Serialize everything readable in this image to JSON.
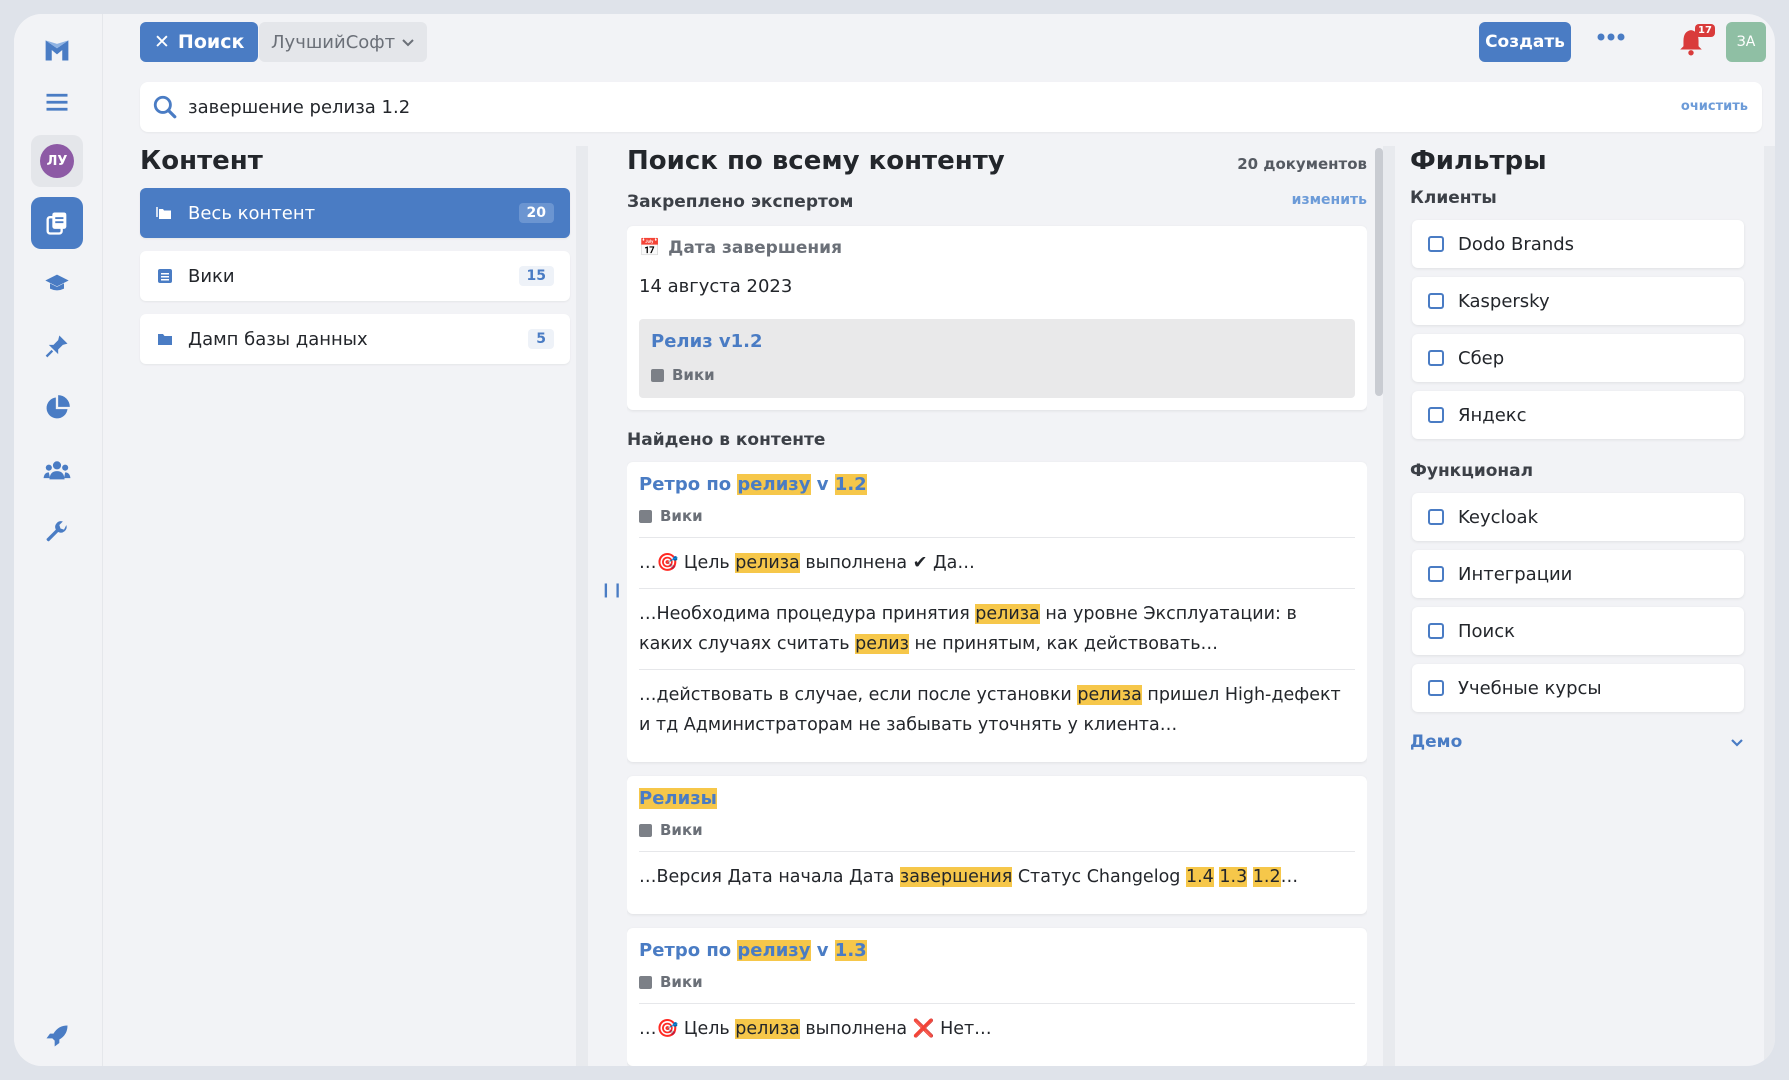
{
  "header": {
    "close_search_label": "Поиск",
    "workspace": "ЛучшийСофт",
    "create_label": "Создать",
    "notifications_count": "17",
    "user_initials": "ЗА"
  },
  "rail": {
    "user_initials": "ЛУ",
    "icons": [
      "menu-icon",
      "avatar",
      "content-icon",
      "courses-icon",
      "pin-icon",
      "analytics-icon",
      "team-icon",
      "settings-icon",
      "rocket-icon"
    ]
  },
  "search": {
    "query": "завершение релиза 1.2",
    "clear_label": "очистить"
  },
  "content": {
    "title": "Контент",
    "items": [
      {
        "label": "Весь контент",
        "count": "20"
      },
      {
        "label": "Вики",
        "count": "15"
      },
      {
        "label": "Дамп базы данных",
        "count": "5"
      }
    ]
  },
  "results": {
    "title": "Поиск по всему контенту",
    "doc_count": "20 документов",
    "pinned_label": "Закреплено экспертом",
    "edit_label": "изменить",
    "pinned": {
      "title": "Дата завершения",
      "date": "14 августа 2023",
      "linked_title": "Релиз v1.2",
      "linked_source": "Вики"
    },
    "found_label": "Найдено в контенте",
    "items": [
      {
        "title_parts": [
          "Ретро по ",
          "релизу",
          " v ",
          "1.2"
        ],
        "source": "Вики",
        "snippets": [
          "…🎯 Цель релиза выполнена ✔ Да…",
          "…Необходима процедура принятия релиза на уровне Эксплуатации: в каких случаях считать релиз не принятым, как действовать…",
          "…действовать в случае, если после установки релиза пришел High-дефект и тд Администраторам не забывать уточнять у клиента…"
        ]
      },
      {
        "title": "Релизы",
        "source": "Вики",
        "snippets": [
          "…Версия Дата начала Дата завершения Статус Changelog 1.4 1.3 1.2…"
        ]
      },
      {
        "title_parts": [
          "Ретро по ",
          "релизу",
          " v ",
          "1.3"
        ],
        "source": "Вики",
        "snippets": [
          "…🎯 Цель релиза выполнена ❌ Нет…"
        ]
      }
    ]
  },
  "filters": {
    "title": "Фильтры",
    "clients_label": "Клиенты",
    "clients": [
      "Dodo Brands",
      "Kaspersky",
      "Сбер",
      "Яндекс"
    ],
    "functional_label": "Функционал",
    "functional": [
      "Keycloak",
      "Интеграции",
      "Поиск",
      "Учебные курсы"
    ],
    "demo_label": "Демо"
  },
  "colors": {
    "accent": "#4a7cc4",
    "highlight": "#f6c74a",
    "badge": "#d93b3b"
  }
}
